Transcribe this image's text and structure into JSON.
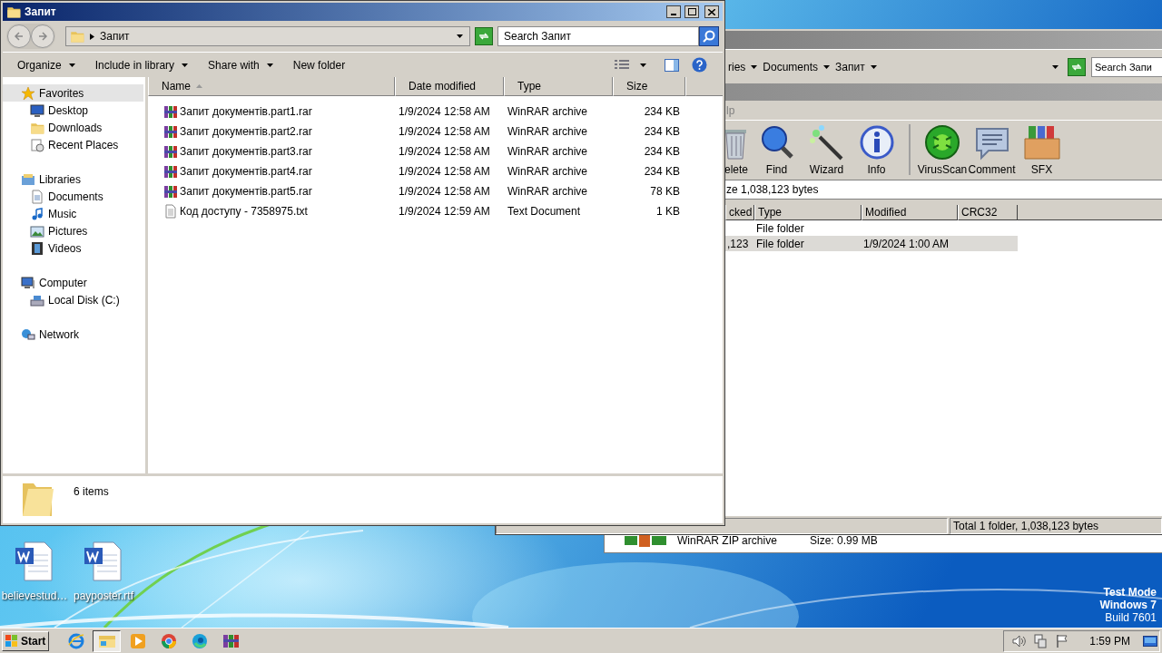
{
  "explorer_window": {
    "title": "Запит",
    "address": {
      "crumbs": [
        "Запит"
      ]
    },
    "search": {
      "placeholder": "Search Запит"
    },
    "commands": [
      {
        "label": "Organize",
        "dropdown": true
      },
      {
        "label": "Include in library",
        "dropdown": true
      },
      {
        "label": "Share with",
        "dropdown": true
      },
      {
        "label": "New folder",
        "dropdown": false
      }
    ],
    "nav_pane": [
      {
        "kind": "star",
        "label": "Favorites",
        "selected": true,
        "children": [
          {
            "kind": "desktop",
            "label": "Desktop",
            "selected": false
          },
          {
            "kind": "downloads",
            "label": "Downloads",
            "selected": false
          },
          {
            "kind": "recent",
            "label": "Recent Places",
            "selected": false
          }
        ]
      },
      {
        "kind": "libraries",
        "label": "Libraries",
        "selected": false,
        "children": [
          {
            "kind": "documents",
            "label": "Documents",
            "selected": false
          },
          {
            "kind": "music",
            "label": "Music",
            "selected": false
          },
          {
            "kind": "pictures",
            "label": "Pictures",
            "selected": false
          },
          {
            "kind": "videos",
            "label": "Videos",
            "selected": false
          }
        ]
      },
      {
        "kind": "computer",
        "label": "Computer",
        "selected": false,
        "children": [
          {
            "kind": "disk",
            "label": "Local Disk (C:)",
            "selected": false
          }
        ]
      },
      {
        "kind": "network",
        "label": "Network",
        "selected": false
      }
    ],
    "columns": [
      {
        "label": "Name",
        "sorted": true
      },
      {
        "label": "Date modified",
        "sorted": false
      },
      {
        "label": "Type",
        "sorted": false
      },
      {
        "label": "Size",
        "sorted": false
      }
    ],
    "files": [
      {
        "kind": "rar",
        "name": "Запит документів.part1.rar",
        "date": "1/9/2024 12:58 AM",
        "type": "WinRAR archive",
        "size": "234 KB"
      },
      {
        "kind": "rar",
        "name": "Запит документів.part2.rar",
        "date": "1/9/2024 12:58 AM",
        "type": "WinRAR archive",
        "size": "234 KB"
      },
      {
        "kind": "rar",
        "name": "Запит документів.part3.rar",
        "date": "1/9/2024 12:58 AM",
        "type": "WinRAR archive",
        "size": "234 KB"
      },
      {
        "kind": "rar",
        "name": "Запит документів.part4.rar",
        "date": "1/9/2024 12:58 AM",
        "type": "WinRAR archive",
        "size": "234 KB"
      },
      {
        "kind": "rar",
        "name": "Запит документів.part5.rar",
        "date": "1/9/2024 12:58 AM",
        "type": "WinRAR archive",
        "size": "78 KB"
      },
      {
        "kind": "txt",
        "name": "Код доступу - 7358975.txt",
        "date": "1/9/2024 12:59 AM",
        "type": "Text Document",
        "size": "1 KB"
      }
    ],
    "details": {
      "count": "6 items"
    }
  },
  "back_explorer_window": {
    "crumbs": [
      "ries",
      "Documents",
      "Запит"
    ],
    "search": {
      "placeholder": "Search Запи"
    }
  },
  "winrar_window": {
    "menu": [
      "lp"
    ],
    "toolbar": [
      {
        "kind": "delete",
        "label": "elete",
        "separated": false
      },
      {
        "kind": "find",
        "label": "Find",
        "separated": false
      },
      {
        "kind": "wizard",
        "label": "Wizard",
        "separated": false
      },
      {
        "kind": "info",
        "label": "Info",
        "separated": false
      },
      {
        "kind": "virusscan",
        "label": "VirusScan",
        "separated": true
      },
      {
        "kind": "comment",
        "label": "Comment",
        "separated": false
      },
      {
        "kind": "sfx",
        "label": "SFX",
        "separated": false
      }
    ],
    "path": "ze 1,038,123 bytes",
    "columns": [
      "cked",
      "Type",
      "Modified",
      "CRC32"
    ],
    "rows": [
      {
        "type": "File folder",
        "selected": false
      },
      {
        "packed": ",123",
        "type": "File folder",
        "modified": "1/9/2024 1:00 AM",
        "selected": true
      }
    ],
    "status": "Total 1 folder, 1,038,123 bytes"
  },
  "zip_window": {
    "type": "WinRAR ZIP archive",
    "size": "Size: 0.99 MB"
  },
  "desktop_icons": [
    {
      "label": "believestud…"
    },
    {
      "label": "payposter.rtf"
    }
  ],
  "os_notice": [
    "Test Mode",
    "Windows 7",
    "Build 7601"
  ],
  "taskbar": {
    "start": "Start",
    "apps": [
      {
        "kind": "ie",
        "active": false
      },
      {
        "kind": "explorer",
        "active": true
      },
      {
        "kind": "media",
        "active": false
      },
      {
        "kind": "chrome",
        "active": false
      },
      {
        "kind": "edge",
        "active": false
      },
      {
        "kind": "winrar",
        "active": false
      }
    ],
    "clock": "1:59 PM"
  }
}
